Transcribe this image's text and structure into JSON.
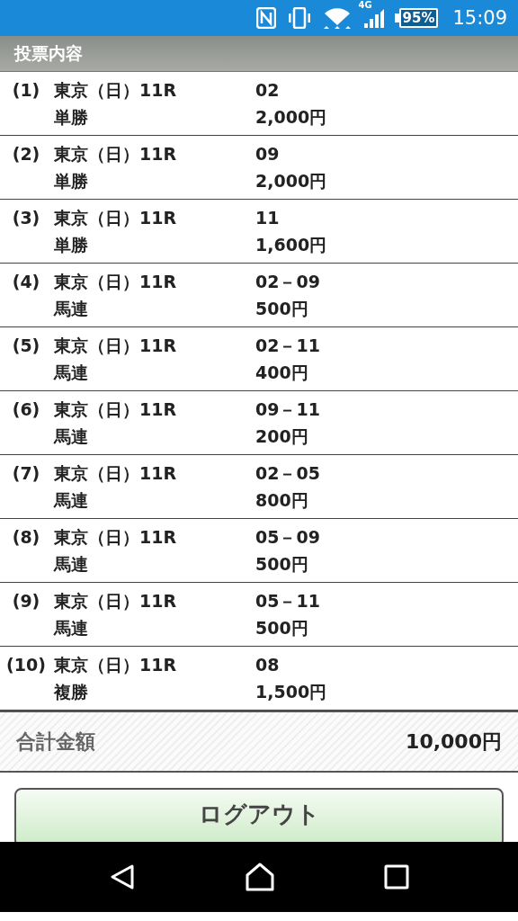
{
  "status_bar": {
    "network": "4G",
    "battery": "95%",
    "time": "15:09"
  },
  "header": {
    "title": "投票内容"
  },
  "bets": [
    {
      "number": "(1)",
      "race": "東京（日）11R",
      "bet_type": "単勝",
      "selection": "02",
      "amount": "2,000円"
    },
    {
      "number": "(2)",
      "race": "東京（日）11R",
      "bet_type": "単勝",
      "selection": "09",
      "amount": "2,000円"
    },
    {
      "number": "(3)",
      "race": "東京（日）11R",
      "bet_type": "単勝",
      "selection": "11",
      "amount": "1,600円"
    },
    {
      "number": "(4)",
      "race": "東京（日）11R",
      "bet_type": "馬連",
      "selection": "02－09",
      "amount": "500円"
    },
    {
      "number": "(5)",
      "race": "東京（日）11R",
      "bet_type": "馬連",
      "selection": "02－11",
      "amount": "400円"
    },
    {
      "number": "(6)",
      "race": "東京（日）11R",
      "bet_type": "馬連",
      "selection": "09－11",
      "amount": "200円"
    },
    {
      "number": "(7)",
      "race": "東京（日）11R",
      "bet_type": "馬連",
      "selection": "02－05",
      "amount": "800円"
    },
    {
      "number": "(8)",
      "race": "東京（日）11R",
      "bet_type": "馬連",
      "selection": "05－09",
      "amount": "500円"
    },
    {
      "number": "(9)",
      "race": "東京（日）11R",
      "bet_type": "馬連",
      "selection": "05－11",
      "amount": "500円"
    },
    {
      "number": "(10)",
      "race": "東京（日）11R",
      "bet_type": "複勝",
      "selection": "08",
      "amount": "1,500円"
    }
  ],
  "total": {
    "label": "合計金額",
    "amount": "10,000円"
  },
  "logout_button": {
    "label": "ログアウト"
  }
}
